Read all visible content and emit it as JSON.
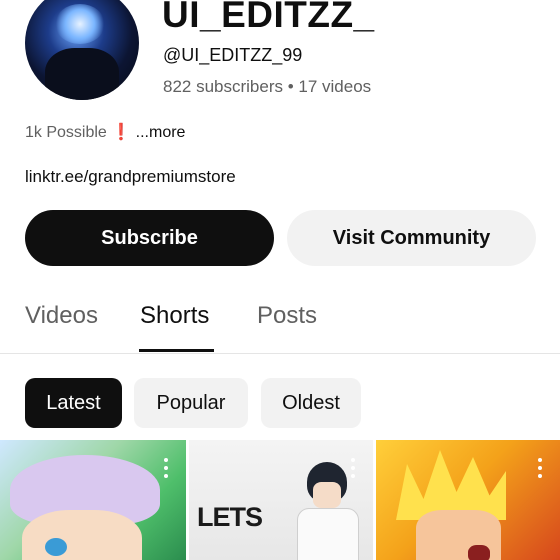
{
  "channel": {
    "name": "UI_EDITZZ_",
    "handle": "@UI_EDITZZ_99",
    "stats": "822 subscribers • 17 videos",
    "description_text": "1k Possible",
    "description_emoji": "❗",
    "description_more": " ...more",
    "link": "linktr.ee/grandpremiumstore"
  },
  "actions": {
    "subscribe_label": "Subscribe",
    "community_label": "Visit Community"
  },
  "tabs": [
    {
      "label": "Videos",
      "active": false
    },
    {
      "label": "Shorts",
      "active": true
    },
    {
      "label": "Posts",
      "active": false
    }
  ],
  "filters": [
    {
      "label": "Latest",
      "active": true
    },
    {
      "label": "Popular",
      "active": false
    },
    {
      "label": "Oldest",
      "active": false
    }
  ],
  "shorts": [
    {
      "overlay_text": "",
      "menu_icon": "more-vert-icon"
    },
    {
      "overlay_text": "LETS",
      "menu_icon": "more-vert-icon"
    },
    {
      "overlay_text": "",
      "menu_icon": "more-vert-icon"
    }
  ],
  "colors": {
    "primary_button": "#0f0f0f",
    "secondary_button": "#f2f2f2",
    "muted_text": "#606060",
    "accent_red": "#e2231a"
  }
}
